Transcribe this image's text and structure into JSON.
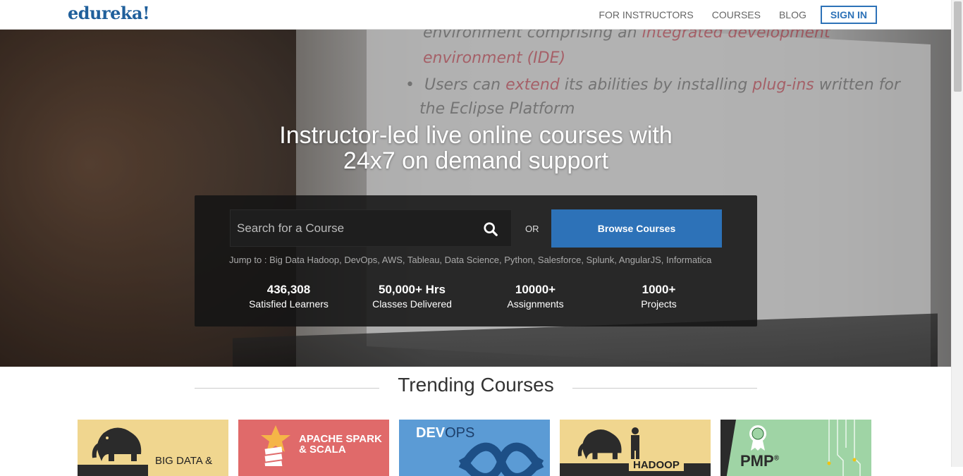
{
  "header": {
    "logo": "edureka!",
    "nav": [
      "FOR INSTRUCTORS",
      "COURSES",
      "BLOG"
    ],
    "signin_label": "SIGN IN"
  },
  "hero": {
    "background_text": {
      "line1": "environment comprising an",
      "line1_red": "integrated development",
      "line2_red": "environment (IDE)",
      "line3_a": "Users can",
      "line3_red": "extend",
      "line3_b": "its abilities by installing",
      "line3_red2": "plug-ins",
      "line3_c": "written for",
      "line4": "the Eclipse Platform"
    },
    "headline_line1": "Instructor-led live online courses with",
    "headline_line2": "24x7 on demand support",
    "search_placeholder": "Search for a Course",
    "or_label": "OR",
    "browse_label": "Browse Courses",
    "jump_to": "Jump to : Big Data Hadoop, DevOps, AWS, Tableau, Data Science, Python, Salesforce, Splunk, AngularJS, Informatica",
    "stats": [
      {
        "value": "436,308",
        "label": "Satisfied Learners"
      },
      {
        "value": "50,000+ Hrs",
        "label": "Classes Delivered"
      },
      {
        "value": "10000+",
        "label": "Assignments"
      },
      {
        "value": "1000+",
        "label": "Projects"
      }
    ]
  },
  "trending": {
    "title": "Trending Courses",
    "cards": [
      {
        "text": "BIG DATA &",
        "bg": "#f0d68f",
        "icon": "elephant-icon"
      },
      {
        "text": "APACHE SPARK & SCALA",
        "line1": "APACHE SPARK",
        "line2": "& SCALA",
        "bg": "#e06a6a",
        "icon": "spark-star-icon"
      },
      {
        "text": "DEVOPS",
        "part1": "DEV",
        "part2": "OPS",
        "bg": "#5b9bd5",
        "icon": "infinity-icon"
      },
      {
        "text": "HADOOP",
        "bg": "#f0d68f",
        "icon": "elephant-icon"
      },
      {
        "text": "PMP",
        "sup": "®",
        "bg": "#9fd4a5",
        "icon": "pmp-badge-icon"
      }
    ]
  },
  "colors": {
    "brand": "#1f5f9b",
    "accent": "#2d72b8"
  }
}
